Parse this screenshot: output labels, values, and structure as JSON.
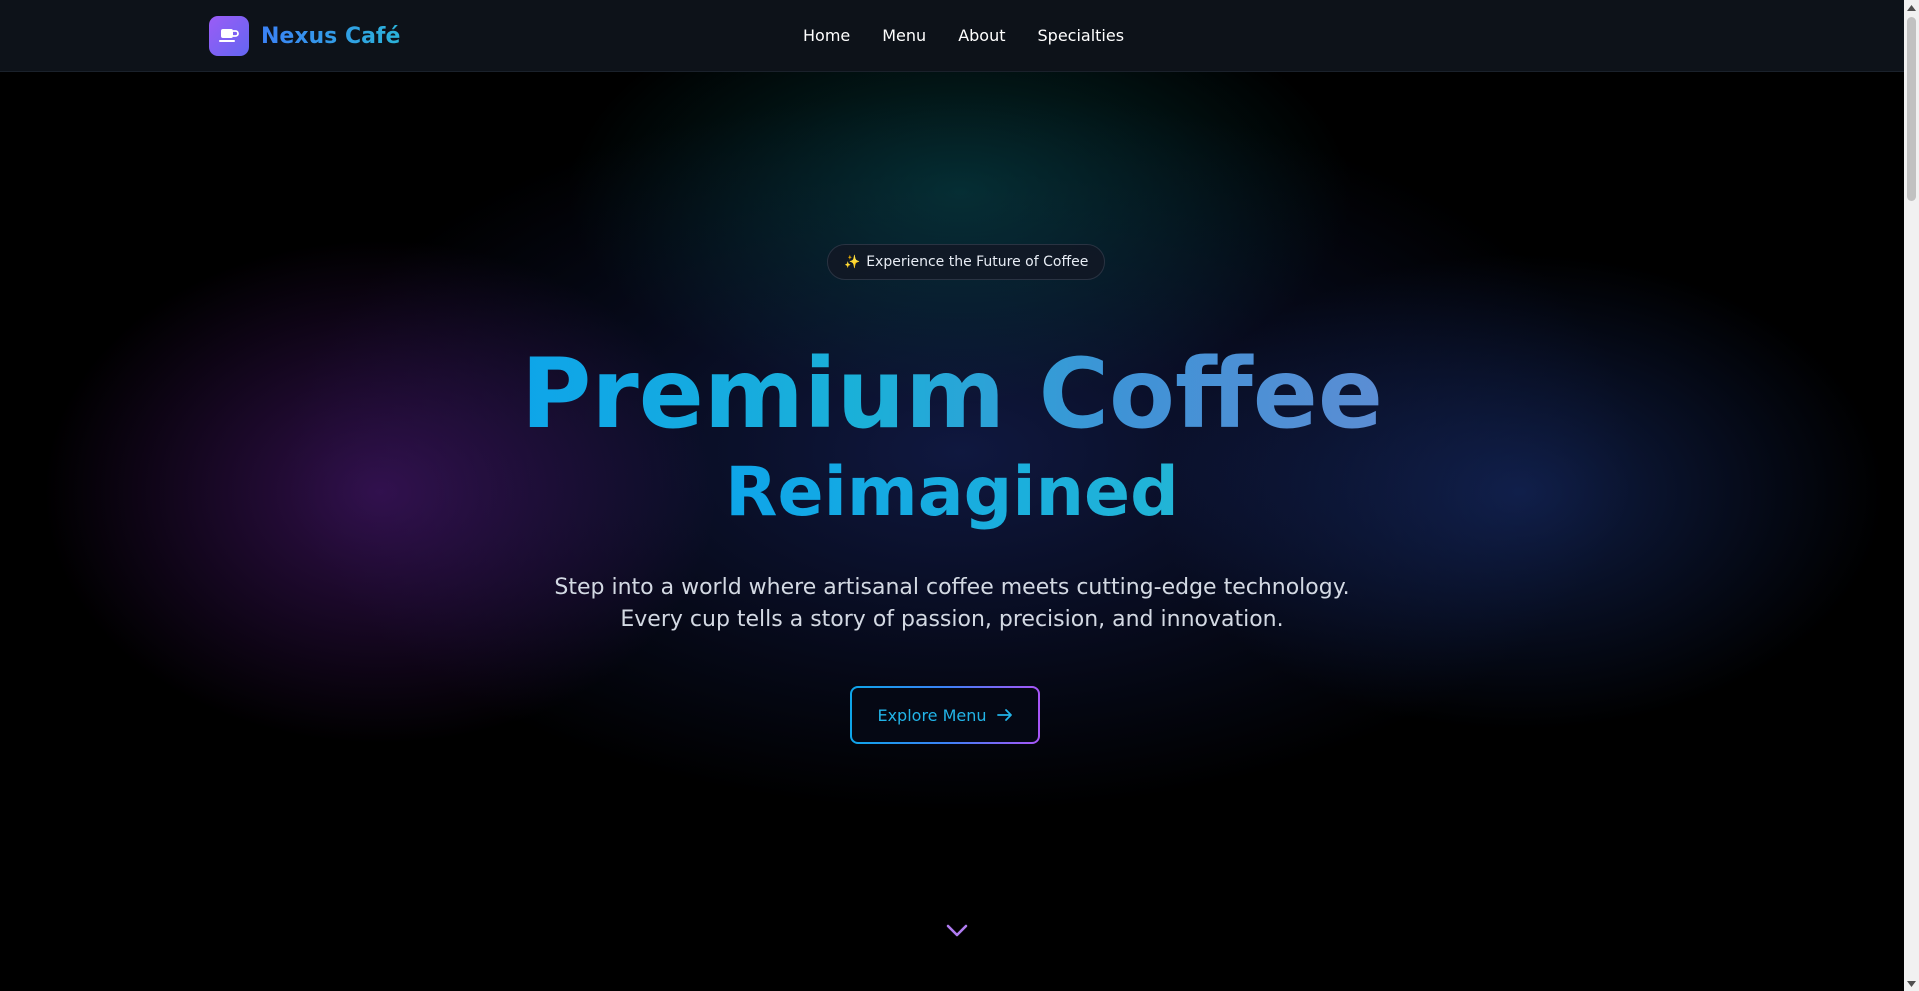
{
  "nav": {
    "brand": "Nexus Café",
    "brand_icon": "coffee-cup-icon",
    "links": [
      "Home",
      "Menu",
      "About",
      "Specialties"
    ]
  },
  "hero": {
    "badge_icon": "✨",
    "badge_text": "Experience the Future of Coffee",
    "title_line1": "Premium Coffee",
    "title_line2": "Reimagined",
    "subtitle_line1": "Step into a world where artisanal coffee meets cutting-edge technology.",
    "subtitle_line2": "Every cup tells a story of passion, precision, and innovation.",
    "cta_label": "Explore Menu",
    "cta_icon": "arrow-right-icon",
    "scroll_icon": "chevron-down-icon"
  },
  "colors": {
    "accent_cyan": "#0ea5e9",
    "accent_blue": "#3b82f6",
    "accent_purple": "#a855f7",
    "nav_bg": "#0d1219"
  }
}
